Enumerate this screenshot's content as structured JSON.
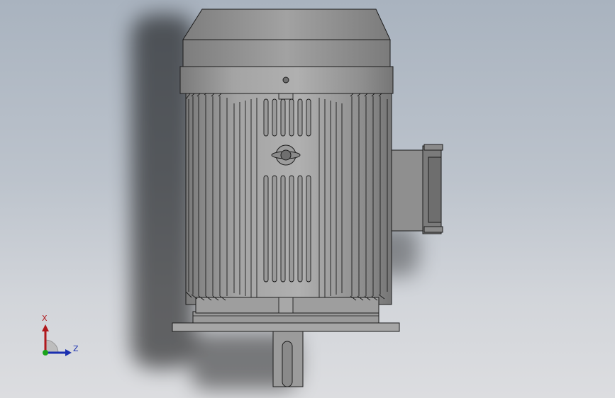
{
  "viewport": {
    "background_top": "#a9b3bf",
    "background_bottom": "#dcdde0"
  },
  "model": {
    "name_icon": "electric-motor",
    "body_color": "#8e8e8e",
    "edge_color": "#1c1c1c"
  },
  "triad": {
    "x_label": "X",
    "z_label": "Z",
    "x_color": "#b0181c",
    "y_color": "#1aa31a",
    "z_color": "#1a2fb0"
  }
}
